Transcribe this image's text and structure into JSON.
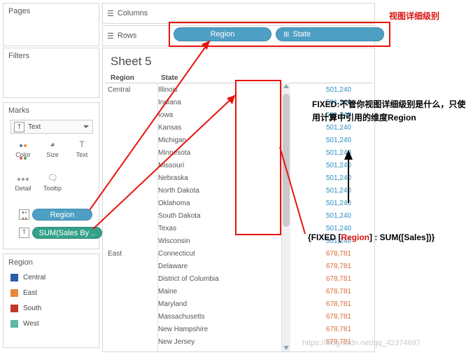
{
  "shelves": {
    "pages_label": "Pages",
    "filters_label": "Filters",
    "marks_label": "Marks",
    "columns_label": "Columns",
    "rows_label": "Rows",
    "columns_icon": "columns-icon",
    "rows_icon": "rows-icon",
    "rows_pills": [
      {
        "label": "Region",
        "icon": "",
        "color": "#4e9fc4"
      },
      {
        "label": "State",
        "icon": "⊞",
        "color": "#4e9fc4"
      }
    ]
  },
  "marks": {
    "type_label": "Text",
    "type_icon": "T",
    "buttons": [
      {
        "label": "Color",
        "icon": "color-dots-icon"
      },
      {
        "label": "Size",
        "icon": "size-icon"
      },
      {
        "label": "Text",
        "icon": "text-icon"
      },
      {
        "label": "Detail",
        "icon": "detail-dots-icon"
      },
      {
        "label": "Tooltip",
        "icon": "tooltip-icon"
      }
    ],
    "pills": [
      {
        "label": "Region",
        "color": "#4e9fc4",
        "icon": "color-dots-icon"
      },
      {
        "label": "SUM(Sales By ..",
        "color": "#36a18b",
        "icon": "T"
      }
    ]
  },
  "legend": {
    "title": "Region",
    "items": [
      {
        "label": "Central",
        "color": "#2a5caa"
      },
      {
        "label": "East",
        "color": "#e8873a"
      },
      {
        "label": "South",
        "color": "#c0392b"
      },
      {
        "label": "West",
        "color": "#5fb7a8"
      }
    ]
  },
  "sheet": {
    "title": "Sheet 5",
    "columns": [
      "Region",
      "State"
    ],
    "rows": [
      {
        "region": "Central",
        "state": "Illinois",
        "value": "501,240",
        "group": "central"
      },
      {
        "region": "",
        "state": "Indiana",
        "value": "501,240",
        "group": "central"
      },
      {
        "region": "",
        "state": "Iowa",
        "value": "501,240",
        "group": "central"
      },
      {
        "region": "",
        "state": "Kansas",
        "value": "501,240",
        "group": "central"
      },
      {
        "region": "",
        "state": "Michigan",
        "value": "501,240",
        "group": "central"
      },
      {
        "region": "",
        "state": "Minnesota",
        "value": "501,240",
        "group": "central"
      },
      {
        "region": "",
        "state": "Missouri",
        "value": "501,240",
        "group": "central"
      },
      {
        "region": "",
        "state": "Nebraska",
        "value": "501,240",
        "group": "central"
      },
      {
        "region": "",
        "state": "North Dakota",
        "value": "501,240",
        "group": "central"
      },
      {
        "region": "",
        "state": "Oklahoma",
        "value": "501,240",
        "group": "central"
      },
      {
        "region": "",
        "state": "South Dakota",
        "value": "501,240",
        "group": "central"
      },
      {
        "region": "",
        "state": "Texas",
        "value": "501,240",
        "group": "central"
      },
      {
        "region": "",
        "state": "Wisconsin",
        "value": "501,240",
        "group": "central"
      },
      {
        "region": "East",
        "state": "Connecticut",
        "value": "678,781",
        "group": "east"
      },
      {
        "region": "",
        "state": "Delaware",
        "value": "678,781",
        "group": "east"
      },
      {
        "region": "",
        "state": "District of Columbia",
        "value": "678,781",
        "group": "east"
      },
      {
        "region": "",
        "state": "Maine",
        "value": "678,781",
        "group": "east"
      },
      {
        "region": "",
        "state": "Maryland",
        "value": "678,781",
        "group": "east"
      },
      {
        "region": "",
        "state": "Massachusetts",
        "value": "678,781",
        "group": "east"
      },
      {
        "region": "",
        "state": "New Hampshire",
        "value": "678,781",
        "group": "east"
      },
      {
        "region": "",
        "state": "New Jersey",
        "value": "678,781",
        "group": "east"
      }
    ]
  },
  "annotations": {
    "top_right": "视图详细级别",
    "fixed_note": "FIXED:不管你视图详细级别是什么，只使用计算中引用的维度Region",
    "formula_prefix": "{FIXED [",
    "formula_dim": "Region",
    "formula_suffix": "] : SUM([Sales])}",
    "watermark": "https://blog.csdn.net/qq_42374697"
  }
}
